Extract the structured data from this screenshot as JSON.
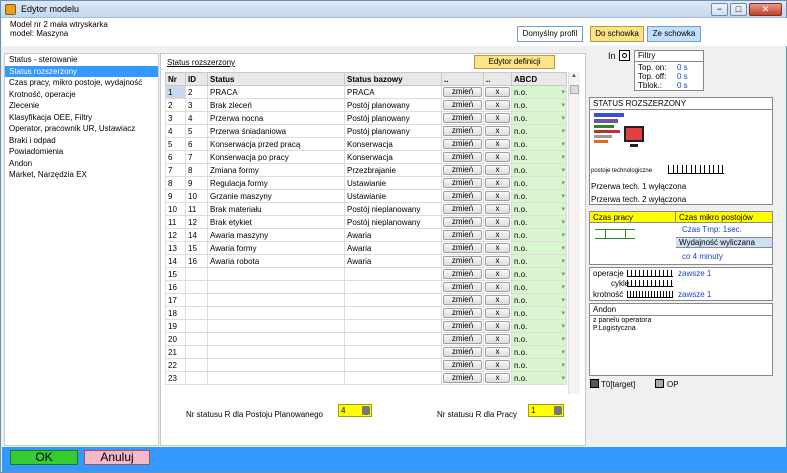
{
  "window": {
    "title": "Edytor modelu",
    "controls": [
      "−",
      "□",
      "✕"
    ]
  },
  "header": {
    "line1": "Model nr 2  mała wtryskarka",
    "line2": "model: Maszyna"
  },
  "top_buttons": {
    "default_profile": "Domyślny profil",
    "to_clipboard": "Do schowka",
    "from_clipboard": "Ze schowka"
  },
  "sidebar": {
    "items": [
      {
        "label": "Status - sterowanie",
        "selected": false
      },
      {
        "label": "Status rozszerzony",
        "selected": true
      },
      {
        "label": "Czas pracy, mikro postoje, wydajność",
        "selected": false
      },
      {
        "label": "Krotność, operacje",
        "selected": false
      },
      {
        "label": "Zlecenie",
        "selected": false
      },
      {
        "label": "Klasyfikacja OEE, Filtry",
        "selected": false
      },
      {
        "label": "Operator, pracownik UR, Ustawiacz",
        "selected": false
      },
      {
        "label": "Braki i odpad",
        "selected": false
      },
      {
        "label": "Powiadomienia",
        "selected": false
      },
      {
        "label": "Andon",
        "selected": false
      },
      {
        "label": "Market, Narzędzia EX",
        "selected": false
      }
    ]
  },
  "main": {
    "section_link": "Status rozszerzony",
    "edit_definitions": "Edytor definicji",
    "columns": [
      "Nr",
      "ID",
      "Status",
      "Status bazowy",
      "..",
      "..",
      "ABCD"
    ],
    "change_label": "zmień",
    "delete_label": "x",
    "abcd_default": "n.o.",
    "rows": [
      {
        "nr": "1",
        "id": "2",
        "status": "PRACA",
        "base": "PRACA"
      },
      {
        "nr": "2",
        "id": "3",
        "status": "Brak zleceń",
        "base": "Postój planowany"
      },
      {
        "nr": "3",
        "id": "4",
        "status": "Przerwa nocna",
        "base": "Postój planowany"
      },
      {
        "nr": "4",
        "id": "5",
        "status": "Przerwa śniadaniowa",
        "base": "Postój planowany"
      },
      {
        "nr": "5",
        "id": "6",
        "status": "Konserwacja przed pracą",
        "base": "Konserwacja"
      },
      {
        "nr": "6",
        "id": "7",
        "status": "Konserwacja po pracy",
        "base": "Konserwacja"
      },
      {
        "nr": "7",
        "id": "8",
        "status": "Zmiana formy",
        "base": "Przezbrajanie"
      },
      {
        "nr": "8",
        "id": "9",
        "status": "Regulacja formy",
        "base": "Ustawianie"
      },
      {
        "nr": "9",
        "id": "10",
        "status": "Grzanie maszyny",
        "base": "Ustawianie"
      },
      {
        "nr": "10",
        "id": "11",
        "status": "Brak materiału",
        "base": "Postój nieplanowany"
      },
      {
        "nr": "11",
        "id": "12",
        "status": "Brak etykiet",
        "base": "Postój nieplanowany"
      },
      {
        "nr": "12",
        "id": "14",
        "status": "Awaria maszyny",
        "base": "Awaria"
      },
      {
        "nr": "13",
        "id": "15",
        "status": "Awaria formy",
        "base": "Awaria"
      },
      {
        "nr": "14",
        "id": "16",
        "status": "Awaria robota",
        "base": "Awaria"
      },
      {
        "nr": "15",
        "id": "",
        "status": "",
        "base": ""
      },
      {
        "nr": "16",
        "id": "",
        "status": "",
        "base": ""
      },
      {
        "nr": "17",
        "id": "",
        "status": "",
        "base": ""
      },
      {
        "nr": "18",
        "id": "",
        "status": "",
        "base": ""
      },
      {
        "nr": "19",
        "id": "",
        "status": "",
        "base": ""
      },
      {
        "nr": "20",
        "id": "",
        "status": "",
        "base": ""
      },
      {
        "nr": "21",
        "id": "",
        "status": "",
        "base": ""
      },
      {
        "nr": "22",
        "id": "",
        "status": "",
        "base": ""
      },
      {
        "nr": "23",
        "id": "",
        "status": "",
        "base": ""
      }
    ],
    "planned_label": "Nr statusu R dla Postoju Planowanego",
    "planned_value": "4",
    "work_label": "Nr statusu R dla Pracy",
    "work_value": "1"
  },
  "right": {
    "in_label": "In",
    "filters_title": "Filtry",
    "filters": [
      {
        "label": "Top. on:",
        "value": "0 s"
      },
      {
        "label": "Top. off:",
        "value": "0 s"
      },
      {
        "label": "Tblok.:",
        "value": "0 s"
      }
    ],
    "status_ext_title": "STATUS ROZSZERZONY",
    "tech_stops": "postoje technologiczne",
    "break1": "Przerwa tech. 1 wyłączona",
    "break2": "Przerwa tech. 2 wyłączona",
    "work_time": "Czas pracy",
    "micro_time": "Czas mikro postojów",
    "tmp": "Czas Tmp: 1sec.",
    "perf": "Wydajność wyliczana",
    "every": "co 4 minuty",
    "operations": "operacje",
    "cycles": "cykle",
    "multiplicity": "krotność",
    "always1": "zawsze 1",
    "always2": "zawsze 1",
    "andon_title": "Andon",
    "andon_line1": "z panelu operatora",
    "andon_line2": "P.Logistyczna",
    "t0": "T0[target]",
    "op": "OP"
  },
  "footer": {
    "ok": "OK",
    "cancel": "Anuluj"
  },
  "colors": {
    "accent": "#3399ff",
    "ok": "#33cc33",
    "cancel": "#f5b8c8",
    "yellow": "#ffff00"
  }
}
